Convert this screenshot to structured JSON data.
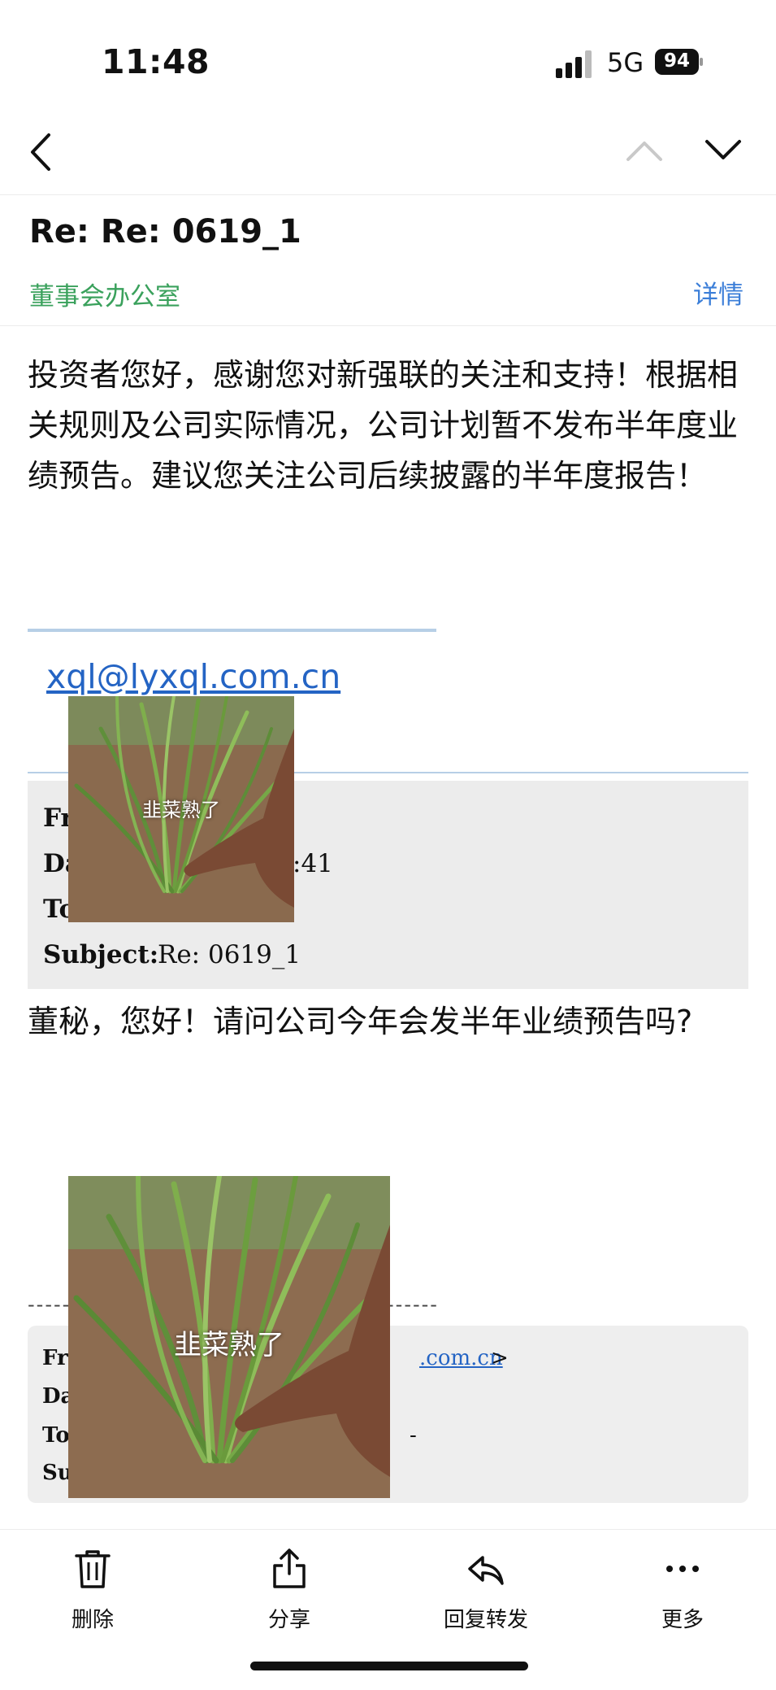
{
  "status_bar": {
    "time": "11:48",
    "network": "5G",
    "battery": "94"
  },
  "message": {
    "subject": "Re: Re: 0619_1",
    "sender": "董事会办公室",
    "details_label": "详情",
    "body": "投资者您好，感谢您对新强联的关注和支持！根据相关规则及公司实际情况，公司计划暂不发布半年度业绩预告。建议您关注公司后续披露的半年度报告！",
    "email_link": "xql@lyxql.com.cn"
  },
  "quote1": {
    "from_partial": "Fr",
    "date_partial": "Da",
    "date_tail": ":41",
    "to_partial": "To",
    "subject_label": "Subject:",
    "subject_value": "Re: 0619_1"
  },
  "question": "董秘，您好！请问公司今年会发半年业绩预告吗?",
  "quote2": {
    "separator_left": "------",
    "separator_right": "------",
    "from_partial": "Fr",
    "link_partial": ".com.cn",
    "link_end": ">",
    "date_partial": "Da",
    "to_partial": "To",
    "to_tail": "-",
    "subject_partial": "Su"
  },
  "memes": [
    {
      "caption": "韭菜熟了"
    },
    {
      "caption": "韭菜熟了"
    }
  ],
  "toolbar": {
    "delete_label": "删除",
    "share_label": "分享",
    "reply_label": "回复转发",
    "more_label": "更多"
  },
  "colors": {
    "accent_green": "#3aa15c",
    "link_blue": "#2464c4",
    "details_blue": "#3b7ed8"
  }
}
